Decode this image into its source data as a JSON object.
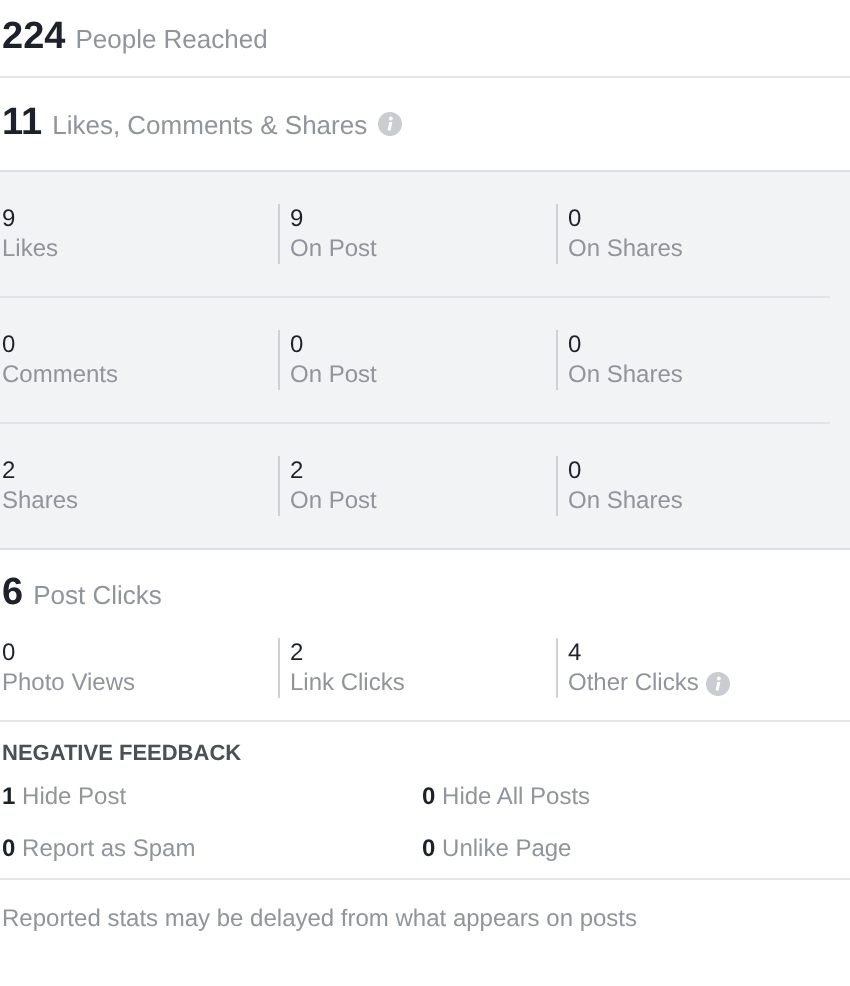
{
  "reach": {
    "value": "224",
    "label": "People Reached"
  },
  "engagement": {
    "value": "11",
    "label": "Likes, Comments & Shares",
    "info": true,
    "rows": [
      [
        {
          "value": "9",
          "label": "Likes"
        },
        {
          "value": "9",
          "label": "On Post"
        },
        {
          "value": "0",
          "label": "On Shares"
        }
      ],
      [
        {
          "value": "0",
          "label": "Comments"
        },
        {
          "value": "0",
          "label": "On Post"
        },
        {
          "value": "0",
          "label": "On Shares"
        }
      ],
      [
        {
          "value": "2",
          "label": "Shares"
        },
        {
          "value": "2",
          "label": "On Post"
        },
        {
          "value": "0",
          "label": "On Shares"
        }
      ]
    ]
  },
  "clicks": {
    "value": "6",
    "label": "Post Clicks",
    "items": [
      {
        "value": "0",
        "label": "Photo Views"
      },
      {
        "value": "2",
        "label": "Link Clicks"
      },
      {
        "value": "4",
        "label": "Other Clicks",
        "info": true
      }
    ]
  },
  "negative_feedback": {
    "title": "NEGATIVE FEEDBACK",
    "items": [
      {
        "value": "1",
        "label": "Hide Post"
      },
      {
        "value": "0",
        "label": "Hide All Posts"
      },
      {
        "value": "0",
        "label": "Report as Spam"
      },
      {
        "value": "0",
        "label": "Unlike Page"
      }
    ]
  },
  "footer": "Reported stats may be delayed from what appears on posts"
}
